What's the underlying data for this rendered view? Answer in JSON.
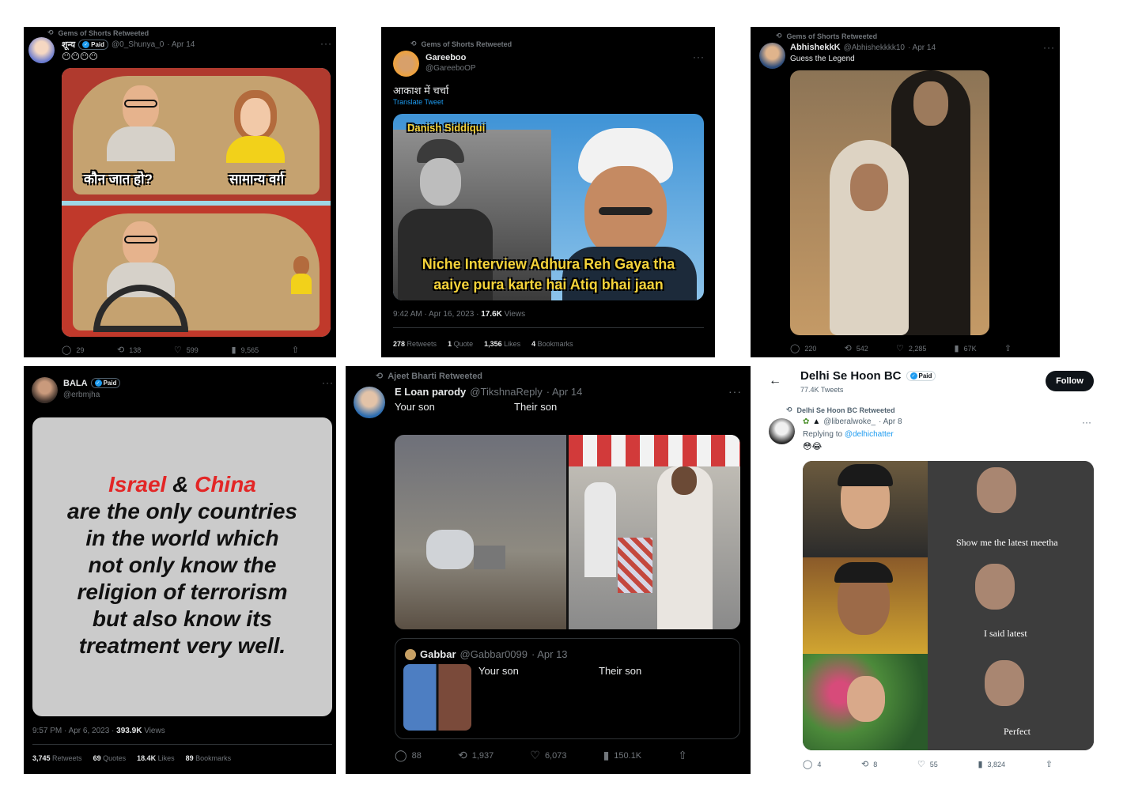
{
  "p1": {
    "retweet": "Gems of Shorts Retweeted",
    "name": "शून्य",
    "paid": "Paid",
    "handle": "@0_Shunya_0",
    "date": "· Apr 14",
    "emojis": "😶😶😶😶",
    "caption_a": "कौन जात हो?",
    "caption_b": "सामान्य वर्ग",
    "replies": "29",
    "retweets": "138",
    "likes": "599",
    "views": "9,565"
  },
  "p2": {
    "retweet": "Gems of Shorts Retweeted",
    "name": "Gareeboo",
    "handle": "@GareeboOP",
    "text": "आकाश में चर्चा",
    "translate": "Translate Tweet",
    "label_top": "Danish Siddiqui",
    "caption_1": "Niche Interview Adhura Reh Gaya tha",
    "caption_2": "aaiye pura karte hai Atiq bhai jaan",
    "time": "9:42 AM · Apr 16, 2023 · ",
    "views_num": "17.6K",
    "views_label": " Views",
    "retweets_num": "278",
    "retweets_label": " Retweets",
    "quotes_num": "1",
    "quotes_label": " Quote",
    "likes_num": "1,356",
    "likes_label": " Likes",
    "bookmarks_num": "4",
    "bookmarks_label": " Bookmarks"
  },
  "p3": {
    "retweet": "Gems of Shorts Retweeted",
    "name": "AbhishekkK",
    "handle": "@Abhishekkkk10",
    "date": "· Apr 14",
    "text": "Guess the Legend",
    "replies": "220",
    "retweets": "542",
    "likes": "2,285",
    "views": "67K"
  },
  "p4": {
    "name": "BALA",
    "paid": "Paid",
    "handle": "@erbmjha",
    "line_israel": "Israel",
    "line_amp": "&",
    "line_china": "China",
    "lines": [
      "are the only countries",
      "in the world which",
      "not only know the",
      "religion of terrorism",
      "but also know its",
      "treatment very well."
    ],
    "time": "9:57 PM · Apr 6, 2023 · ",
    "views_num": "393.9K",
    "views_label": " Views",
    "retweets_num": "3,745",
    "retweets_label": " Retweets",
    "quotes_num": "69",
    "quotes_label": " Quotes",
    "likes_num": "18.4K",
    "likes_label": " Likes",
    "bookmarks_num": "89",
    "bookmarks_label": " Bookmarks"
  },
  "p5": {
    "retweet": "Ajeet Bharti Retweeted",
    "name": "E Loan parody",
    "handle": "@TikshnaReply",
    "date": "· Apr 14",
    "your_son": "Your son",
    "their_son": "Their son",
    "q_name": "Gabbar",
    "q_handle": "@Gabbar0099",
    "q_date": "· Apr 13",
    "q_your_son": "Your son",
    "q_their_son": "Their son",
    "replies": "88",
    "retweets": "1,937",
    "likes": "6,073",
    "views": "150.1K"
  },
  "p6": {
    "title": "Delhi Se Hoon BC",
    "paid": "Paid",
    "tweets": "77.4K Tweets",
    "follow": "Follow",
    "retweet": "Delhi Se Hoon BC Retweeted",
    "handle": "@liberalwoke_",
    "date": "· Apr 8",
    "replying": "Replying to ",
    "replying_to": "@delhichatter",
    "emojis": "😳😂",
    "cap1": "Show me the latest meetha",
    "cap2": "I said latest",
    "cap3": "Perfect",
    "replies": "4",
    "retweets": "8",
    "likes": "55",
    "views": "3,824"
  }
}
